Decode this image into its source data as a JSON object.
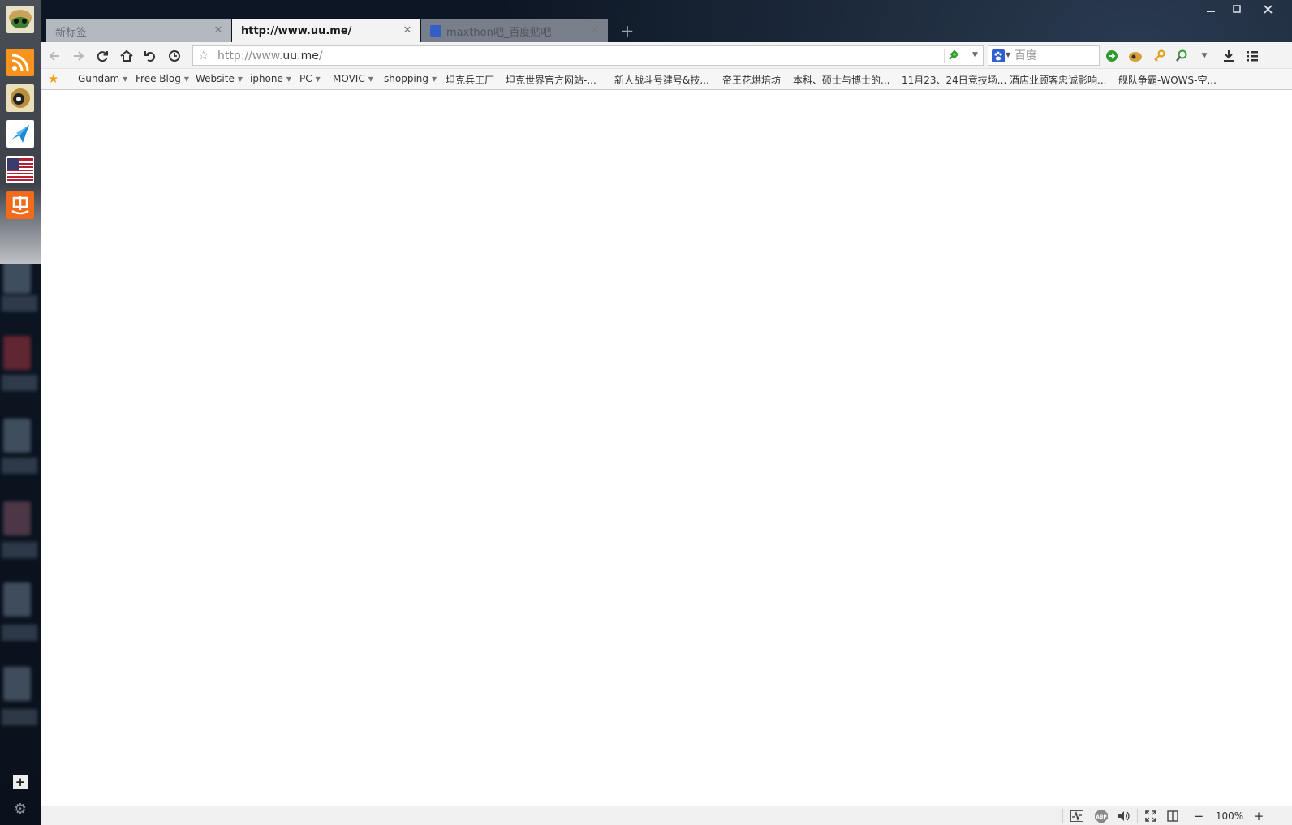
{
  "sidebar": {
    "apps": [
      {
        "name": "maxthon-avatar-icon"
      },
      {
        "name": "rss-icon"
      },
      {
        "name": "game-app-icon"
      },
      {
        "name": "bird-app-icon"
      },
      {
        "name": "us-flag-icon"
      },
      {
        "name": "hui-deals-icon"
      }
    ],
    "add_label": "+",
    "settings_icon": "gear-icon"
  },
  "window": {
    "minimize": "minimize-icon",
    "maximize": "maximize-icon",
    "close": "close-icon"
  },
  "tabs": [
    {
      "title": "新标签",
      "active": false
    },
    {
      "title": "http://www.uu.me/",
      "active": true
    },
    {
      "title": "maxthon吧_百度贴吧",
      "active": false
    }
  ],
  "toolbar": {
    "buttons": [
      "back-icon",
      "forward-icon",
      "refresh-icon",
      "home-icon",
      "undo-icon",
      "history-icon"
    ],
    "address_prefix": "http://www.",
    "address_domain": "uu.me",
    "address_suffix": "/",
    "search_placeholder": "百度",
    "right_icons": [
      "go-icon",
      "extensions-icon",
      "password-key-icon",
      "zoom-search-icon",
      "more-caret-icon",
      "download-icon",
      "menu-icon"
    ]
  },
  "bookmarks": {
    "folders": [
      {
        "label": "Gundam",
        "folder": true
      },
      {
        "label": "Free Blog",
        "folder": true
      },
      {
        "label": "Website",
        "folder": true
      },
      {
        "label": "iphone",
        "folder": true
      },
      {
        "label": "PC",
        "folder": true
      },
      {
        "label": "MOVIC",
        "folder": true
      },
      {
        "label": "shopping",
        "folder": true
      },
      {
        "label": "坦克兵工厂",
        "folder": false
      },
      {
        "label": "坦克世界官方网站-...",
        "folder": false
      },
      {
        "label": "新人战斗号建号&技...",
        "folder": false
      },
      {
        "label": "帝王花烘培坊",
        "folder": false
      },
      {
        "label": "本科、硕士与博士的...",
        "folder": false
      },
      {
        "label": "11月23、24日竞技场...",
        "folder": false
      },
      {
        "label": "酒店业顾客忠诚影响...",
        "folder": false
      },
      {
        "label": "舰队争霸-WOWS-空...",
        "folder": false
      }
    ]
  },
  "statusbar": {
    "zoom": "100%",
    "zoom_out": "−",
    "zoom_in": "+",
    "abp_label": "ABP"
  },
  "colors": {
    "accent_orange": "#f0a11c",
    "rss_orange": "#f7941d",
    "go_green": "#2e9a2e"
  }
}
